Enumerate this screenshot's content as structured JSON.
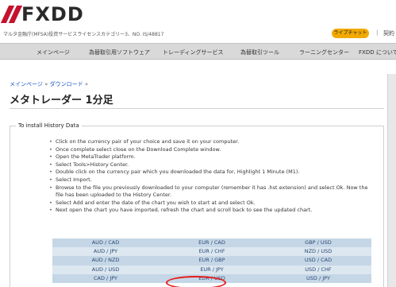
{
  "header": {
    "logo_text": "FXDD",
    "license": "マルタ金融庁(MFSA)投資サービスライセンスカテゴリー3、NO. IS/48817",
    "live_chat": "ライブチャット",
    "separator": "|",
    "about": "契約",
    "brand_color": "#c4122f",
    "live_chat_color": "#f2a900"
  },
  "nav": {
    "items": [
      "メインページ",
      "為替取引用ソフトウェア",
      "トレーディングサービス",
      "為替取引ツール",
      "ラーニングセンター",
      "FXDD について"
    ]
  },
  "breadcrumb": {
    "items": [
      "メインページ",
      "ダウンロード"
    ],
    "arrow": "»"
  },
  "page_title": "メタトレーダー 1分足",
  "section": {
    "legend": "To install History Data",
    "steps": [
      "Click on the currency pair of your choice and save it on your computer.",
      "Once complete select close on the Download Complete window.",
      "Open the MetaTrader platform.",
      "Select Tools>History Center.",
      "Double click on the currency pair which you downloaded the data for, Highlight 1 Minute (M1).",
      "Select Import.",
      "Browse to the file you previously downloaded to your computer (remember it has .hst extension) and select Ok. Now the file has been uploaded to the History Center.",
      "Select Add and enter the date of the chart you wish to start at and select Ok.",
      "Next open the chart you have imported, refresh the chart and scroll back to see the updated chart."
    ]
  },
  "pairs": [
    [
      "AUD / CAD",
      "EUR / CAD",
      "GBP / USD"
    ],
    [
      "AUD / JPY",
      "EUR / CHF",
      "NZD / USD"
    ],
    [
      "AUD / NZD",
      "EUR / GBP",
      "USD / CAD"
    ],
    [
      "AUD / USD",
      "EUR / JPY",
      "USD / CHF"
    ],
    [
      "CAD / JPY",
      "EUR / USD",
      "USD / JPY"
    ]
  ],
  "highlight_color": "#e41b1b"
}
